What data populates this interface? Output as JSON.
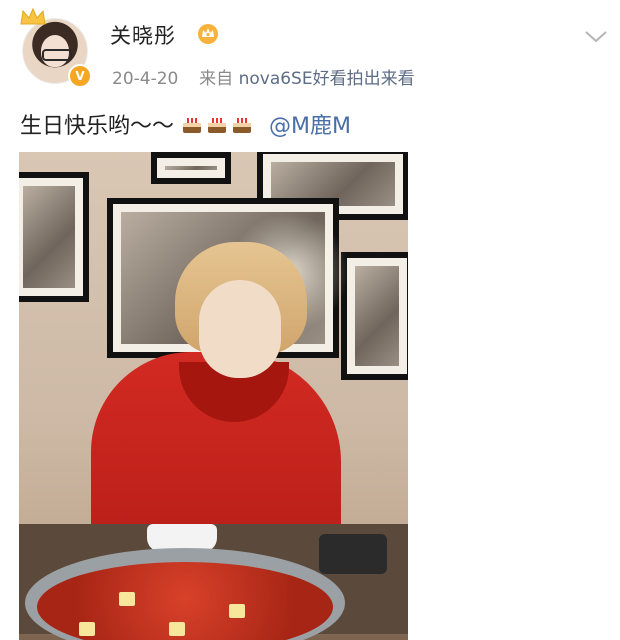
{
  "post": {
    "author": {
      "name": "关晓彤",
      "avatar": "user-avatar",
      "verified_icon": "verified-v-icon",
      "vip_icon": "crown-icon"
    },
    "meta": {
      "date": "20-4-20",
      "source_prefix": "来自",
      "source": "nova6SE好看拍出来看"
    },
    "text": {
      "content": "生日快乐哟～～",
      "emoji": [
        "cake-emoji",
        "cake-emoji",
        "cake-emoji"
      ],
      "mention": "@M鹿M"
    },
    "photo": {
      "description_icon": "photo-image"
    }
  },
  "colors": {
    "mention": "#4a6ea6",
    "meta": "#8a8a8a",
    "source": "#5d6d86",
    "verified_badge": "#f5a623"
  }
}
